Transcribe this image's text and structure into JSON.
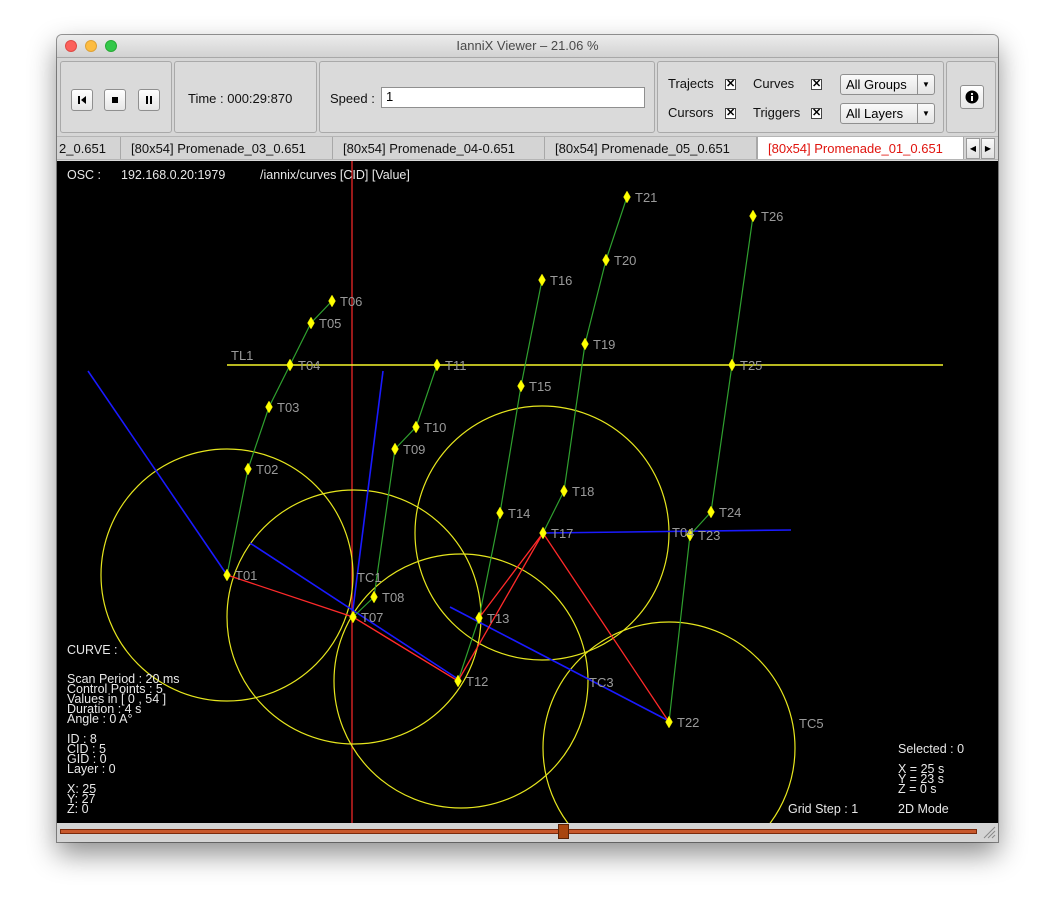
{
  "window": {
    "title": "IanniX Viewer – 21.06 %"
  },
  "toolbar": {
    "time_label": "Time : 000:29:870",
    "speed_label": "Speed :",
    "speed_value": "1",
    "toggles": [
      {
        "label": "Trajects",
        "checked": true
      },
      {
        "label": "Curves",
        "checked": true
      },
      {
        "label": "Cursors",
        "checked": true
      },
      {
        "label": "Triggers",
        "checked": true
      }
    ],
    "groups_select": "All Groups",
    "layers_select": "All Layers"
  },
  "tabs": [
    {
      "label": "2_0.651",
      "active": false
    },
    {
      "label": "[80x54] Promenade_03_0.651",
      "active": false
    },
    {
      "label": "[80x54] Promenade_04-0.651",
      "active": false
    },
    {
      "label": "[80x54] Promenade_05_0.651",
      "active": false
    },
    {
      "label": "[80x54] Promenade_01_0.651",
      "active": true
    }
  ],
  "viewer": {
    "osc_label": "OSC :",
    "osc_address": "192.168.0.20:1979",
    "osc_path": "/iannix/curves [CID] [Value]",
    "curve_info": {
      "title": "CURVE :",
      "scan_period": "Scan Period : 20 ms",
      "control_points": "Control Points : 5",
      "values_in": "Values in [ 0 , 54 ]",
      "duration": "Duration : 4 s",
      "angle": "Angle : 0 A°",
      "id": "ID : 8",
      "cid": "CID : 5",
      "gid": "GID : 0",
      "layer": "Layer : 0",
      "x": "X: 25",
      "y": "Y: 27",
      "z": "Z: 0"
    },
    "status": {
      "selected": "Selected : 0",
      "x": "X = 25 s",
      "y": "Y = 23 s",
      "z": "Z = 0 s",
      "grid_step": "Grid Step : 1",
      "mode": "2D Mode"
    },
    "curve_labels": [
      "TL1",
      "TC1",
      "TC3",
      "TC5"
    ],
    "triggers": [
      "T01",
      "T02",
      "T03",
      "T04",
      "T05",
      "T06",
      "T07",
      "T08",
      "T09",
      "T10",
      "T11",
      "T12",
      "T13",
      "T14",
      "T15",
      "T16",
      "T17",
      "T18",
      "T19",
      "T20",
      "T21",
      "T22",
      "T23",
      "T24",
      "T25",
      "T26",
      "T04"
    ],
    "colors": {
      "background": "#000000",
      "circle": "#e6e61e",
      "line": "#1a1aff",
      "cursor": "#ff2a2a",
      "trajectory": "#2fa02f",
      "trigger": "#ffff00",
      "timeline": "#f5f52a"
    }
  },
  "slider": {
    "position_fraction": 0.54
  }
}
